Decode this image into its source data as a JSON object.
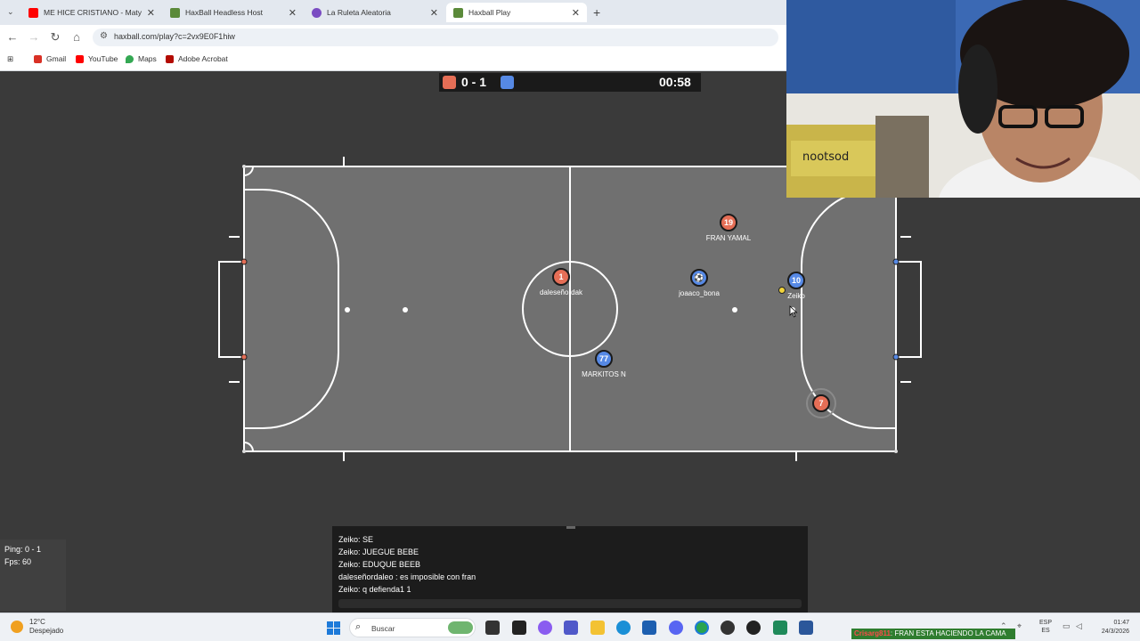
{
  "browser": {
    "tabs": [
      {
        "title": "ME HICE CRISTIANO - Matysito",
        "favicon_color": "#ff0000",
        "active": false
      },
      {
        "title": "HaxBall Headless Host",
        "favicon_color": "#5b8a3a",
        "active": false
      },
      {
        "title": "La Ruleta Aleatoria",
        "favicon_color": "#7a4cc2",
        "active": false
      },
      {
        "title": "Haxball Play",
        "favicon_color": "#5b8a3a",
        "active": true
      }
    ],
    "url": "haxball.com/play?c=2vx9E0F1hiw",
    "bookmarks": [
      {
        "label": "Gmail",
        "color": "#d93025"
      },
      {
        "label": "YouTube",
        "color": "#ff0000"
      },
      {
        "label": "Maps",
        "color": "#34a853"
      },
      {
        "label": "Adobe Acrobat",
        "color": "#b30b00"
      }
    ]
  },
  "scoreboard": {
    "red_color": "#e56e56",
    "blue_color": "#5689e5",
    "score": "0 - 1",
    "time": "00:58"
  },
  "players": [
    {
      "team": "red",
      "number": "19",
      "name": "FRAN YAMAL"
    },
    {
      "team": "red",
      "number": "1",
      "name": "daleseñordak"
    },
    {
      "team": "blue",
      "number": "⚽",
      "name": "joaaco_bona"
    },
    {
      "team": "blue",
      "number": "10",
      "name": "Zeiko"
    },
    {
      "team": "blue",
      "number": "77",
      "name": "MARKITOS N"
    },
    {
      "team": "red",
      "number": "7",
      "name": ""
    }
  ],
  "stats": {
    "ping": "Ping: 0 - 1",
    "fps": "Fps: 60"
  },
  "chat": {
    "messages": [
      "Zeiko: SE",
      "Zeiko: JUEGUE BEBE",
      "Zeiko: EDUQUE BEEB",
      "daleseñordaleo : es imposible con fran",
      "Zeiko: q defienda1 1"
    ]
  },
  "taskbar": {
    "weather_temp": "12°C",
    "weather_desc": "Despejado",
    "search_placeholder": "Buscar",
    "lang_top": "ESP",
    "lang_bottom": "ES",
    "time": "01:47",
    "date": "24/3/2026",
    "ticker_user": "Crisarg811",
    "ticker_text": ": FRAN ESTA HACIENDO LA CAMA"
  }
}
